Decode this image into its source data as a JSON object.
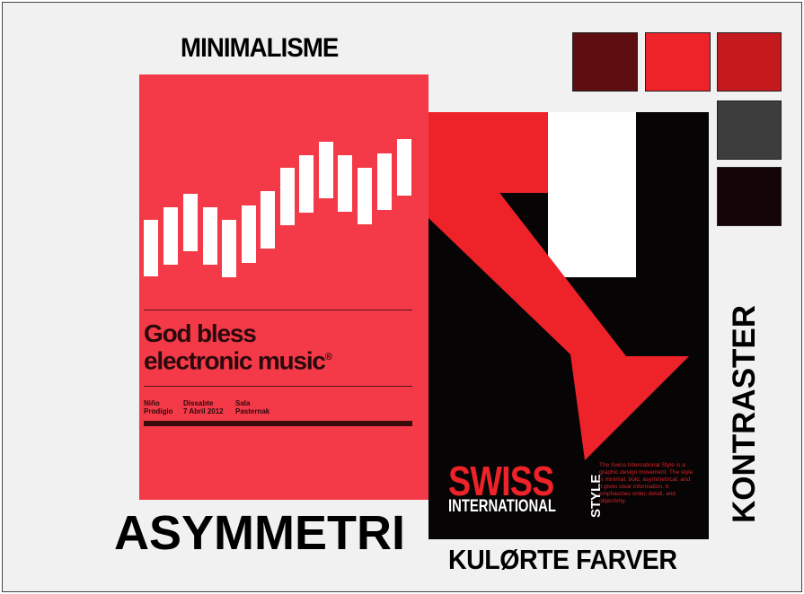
{
  "labels": {
    "minimalisme": "MINIMALISME",
    "asymmetri": "ASYMMETRI",
    "kulorte_farver": "KULØRTE FARVER",
    "kontraster": "KONTRASTER"
  },
  "poster_electronic": {
    "title_line1": "God bless",
    "title_line2": "electronic music",
    "registered_mark": "®",
    "info_col1": [
      "Niño",
      "Prodigio"
    ],
    "info_col2": [
      "Dissabte",
      "7 Abril 2012"
    ],
    "info_col3": [
      "Sala",
      "Pasternak"
    ],
    "background": "#f43948"
  },
  "poster_swiss": {
    "swiss": "SWISS",
    "international": "INTERNATIONAL",
    "style": "STYLE",
    "blurb": "The Swiss International Style is a graphic design movement. The style is minimal, bold, asymmetrical, and it gives clear information. It emphasizes order, detail, and objectivity.",
    "red": "#ee2229",
    "black": "#060404"
  },
  "swatches": [
    {
      "name": "dark-red",
      "color": "#5e0e11"
    },
    {
      "name": "bright-red",
      "color": "#ee2229"
    },
    {
      "name": "crimson",
      "color": "#c4191d"
    },
    {
      "name": "charcoal",
      "color": "#3d3d3d"
    },
    {
      "name": "near-black",
      "color": "#140406"
    }
  ]
}
